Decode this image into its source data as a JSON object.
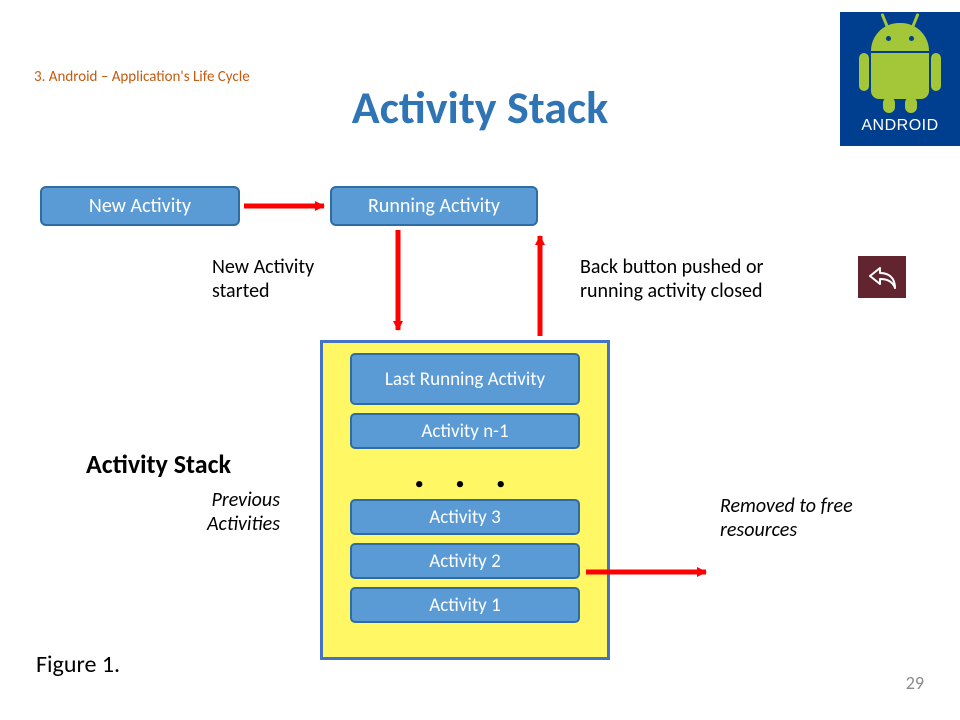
{
  "header": {
    "section_label": "3. Android – Application's Life Cycle",
    "title": "Activity Stack",
    "logo_word": "ANDROID"
  },
  "boxes": {
    "new_activity": "New Activity",
    "running_activity": "Running Activity"
  },
  "captions": {
    "new_started": "New Activity started",
    "back_pushed": "Back button pushed or running activity closed",
    "stack_title": "Activity Stack",
    "previous": "Previous Activities",
    "removed": "Removed to free resources",
    "figure": "Figure 1."
  },
  "stack": {
    "top": "Last Running Activity",
    "n1": "Activity n-1",
    "dots": ". . .",
    "a3": "Activity 3",
    "a2": "Activity 2",
    "a1": "Activity 1"
  },
  "page_number": "29"
}
